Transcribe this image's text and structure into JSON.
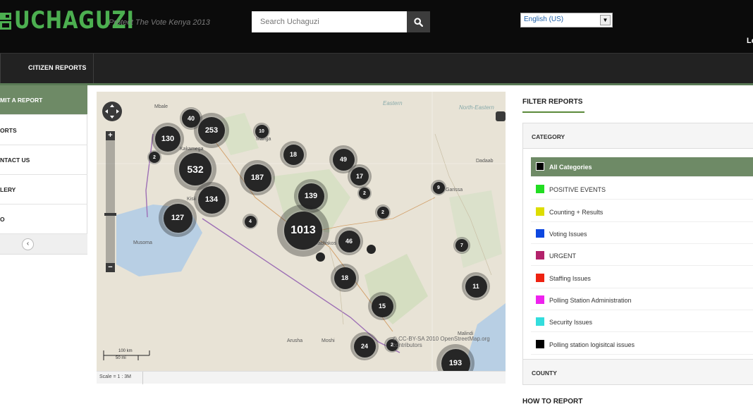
{
  "header": {
    "logo_text": "UCHAGUZI",
    "tagline": "Protect The Vote Kenya 2013",
    "search": {
      "placeholder": "Search Uchaguzi"
    },
    "language": "English (US)",
    "login_fragment": "Lo"
  },
  "nav": {
    "items": [
      {
        "label": "CITIZEN REPORTS"
      }
    ]
  },
  "sidebar": {
    "items": [
      {
        "label": "MIT A REPORT",
        "active": true
      },
      {
        "label": "ORTS"
      },
      {
        "label": "NTACT US"
      },
      {
        "label": "LERY"
      },
      {
        "label": "O"
      }
    ],
    "collapse_icon": "chevron-left-icon"
  },
  "map": {
    "clusters": [
      {
        "label": "40"
      },
      {
        "label": "130"
      },
      {
        "label": "253"
      },
      {
        "label": "10"
      },
      {
        "label": "2"
      },
      {
        "label": "532"
      },
      {
        "label": "18"
      },
      {
        "label": "49"
      },
      {
        "label": "187"
      },
      {
        "label": "17"
      },
      {
        "label": "2"
      },
      {
        "label": "9"
      },
      {
        "label": "139"
      },
      {
        "label": "134"
      },
      {
        "label": "2"
      },
      {
        "label": "127"
      },
      {
        "label": "4"
      },
      {
        "label": "1013"
      },
      {
        "label": "46"
      },
      {
        "label": "7"
      },
      {
        "label": "18"
      },
      {
        "label": "11"
      },
      {
        "label": "15"
      },
      {
        "label": "24"
      },
      {
        "label": "2"
      },
      {
        "label": "193"
      }
    ],
    "places": {
      "mbale": "Mbale",
      "kakamega": "Kakamega",
      "kisumu": "Kisii",
      "musoma": "Musoma",
      "machakos": "Machakos",
      "arusha": "Arusha",
      "moshi": "Moshi",
      "malindi": "Malindi",
      "dadaab": "Dadaab",
      "garissa": "Garissa",
      "manga": "Manga",
      "eastern": "Eastern",
      "northeastern": "North-Eastern"
    },
    "attribution": "© CC-BY-SA 2010 OpenStreetMap.org contributors",
    "scale_km": "100 km",
    "scale_mi": "50 mi",
    "scale_text": "Scale = 1 : 3M"
  },
  "filters": {
    "title": "FILTER REPORTS",
    "category_head": "CATEGORY",
    "categories": [
      {
        "label": "All Categories",
        "color": "#000000",
        "active": true
      },
      {
        "label": "POSITIVE EVENTS",
        "color": "#22dd22"
      },
      {
        "label": "Counting + Results",
        "color": "#dddd00"
      },
      {
        "label": "Voting Issues",
        "color": "#0d47e0"
      },
      {
        "label": "URGENT",
        "color": "#b3226b"
      },
      {
        "label": "Staffing Issues",
        "color": "#ee2211"
      },
      {
        "label": "Polling Station Administration",
        "color": "#ee22ee"
      },
      {
        "label": "Security Issues",
        "color": "#33dddd"
      },
      {
        "label": "Polling station logisitcal issues",
        "color": "#000000"
      }
    ],
    "county_head": "COUNTY",
    "howto": "HOW TO REPORT"
  }
}
